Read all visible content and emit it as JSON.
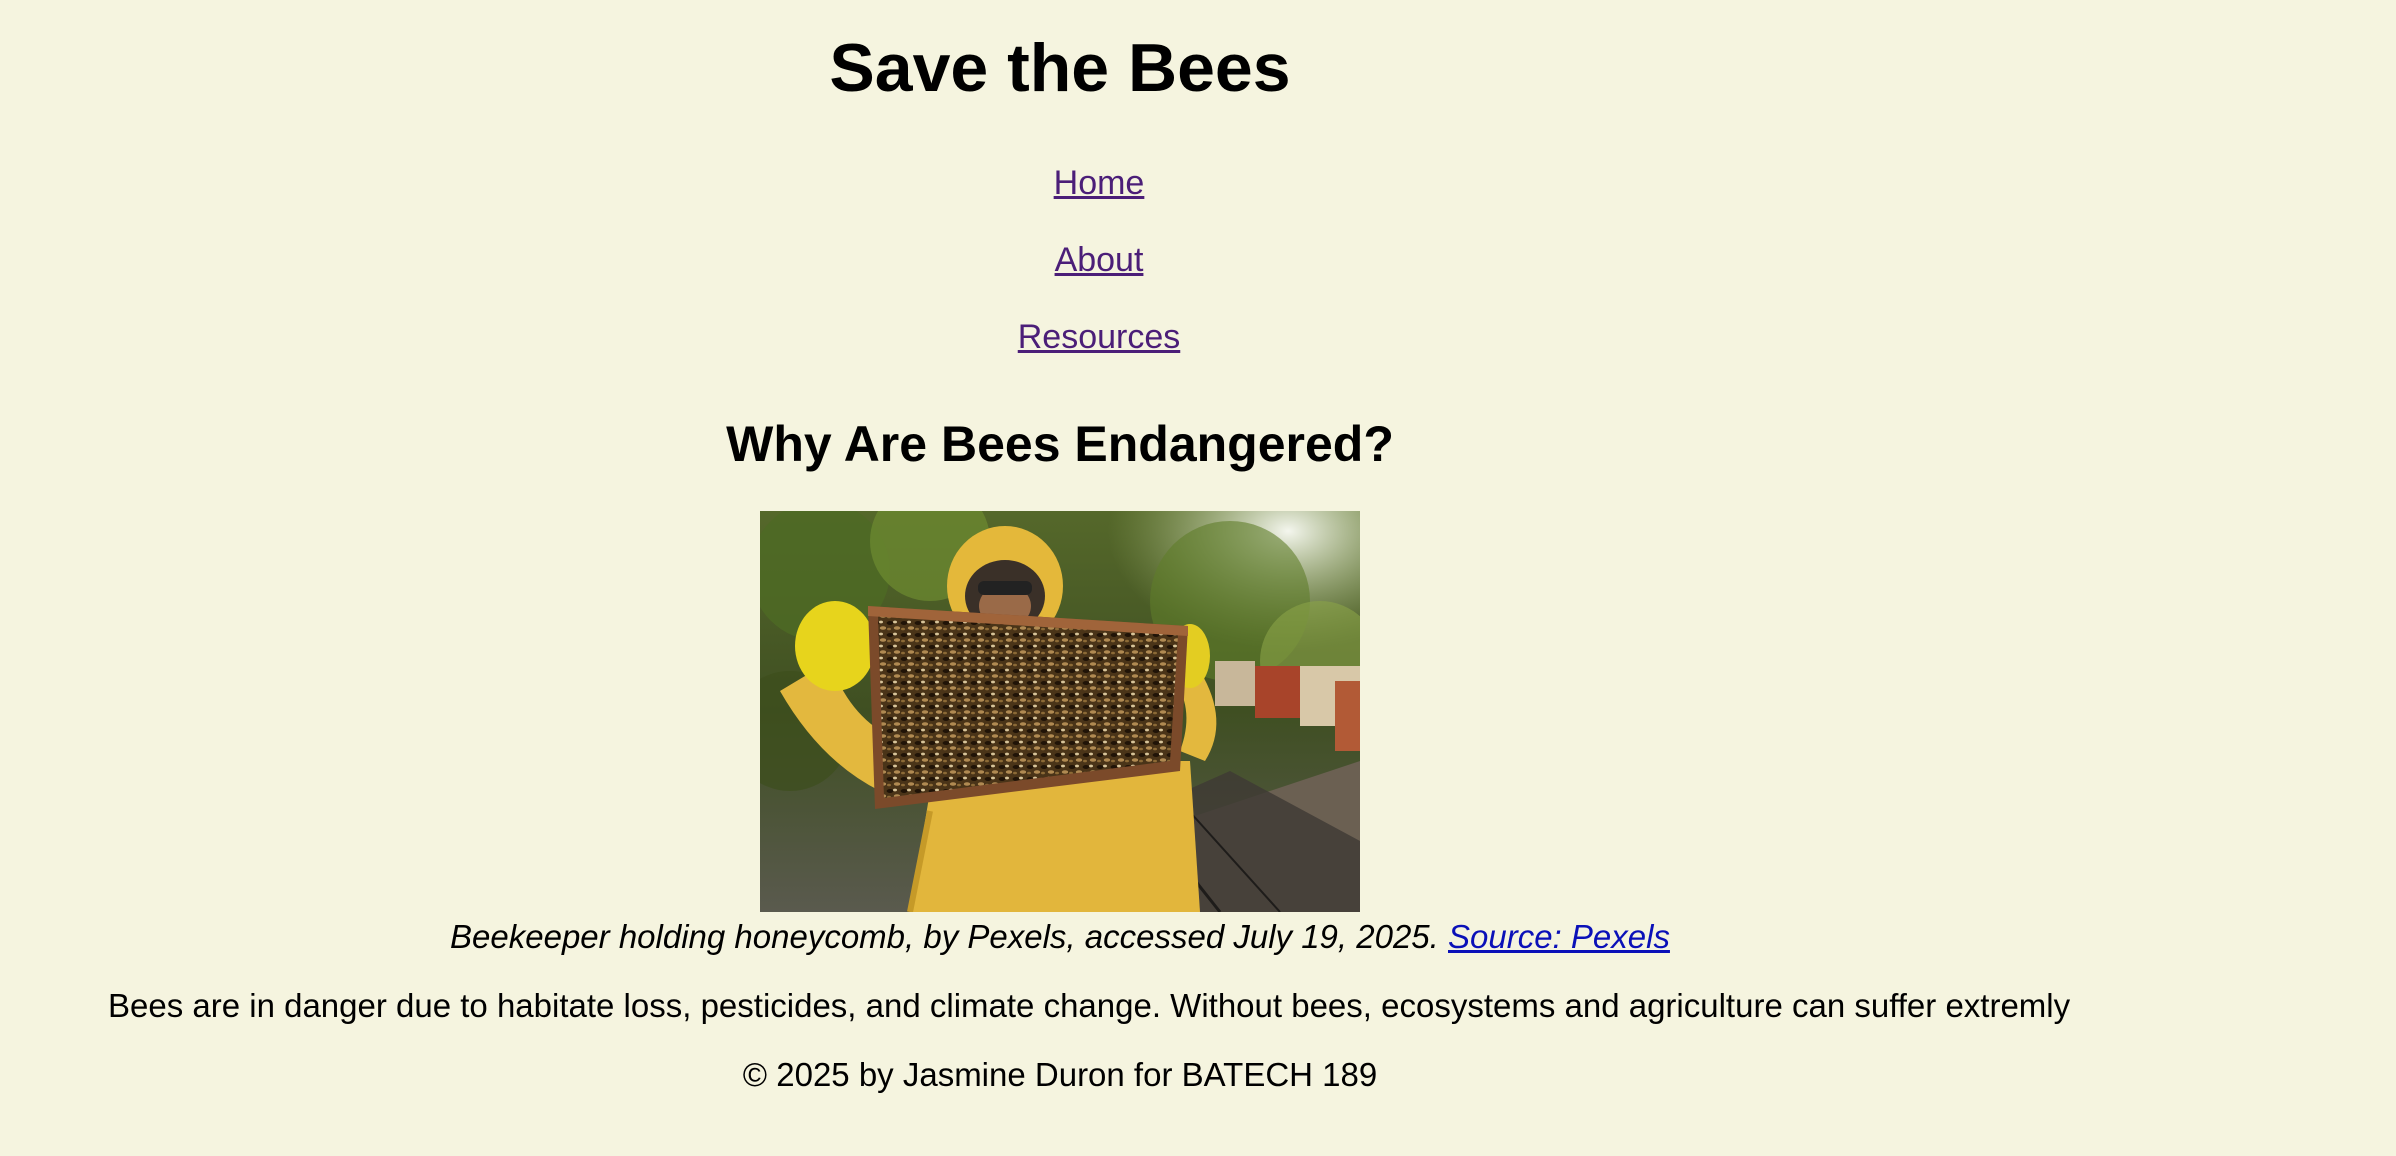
{
  "page": {
    "background_color": "#f5f4df",
    "link_color": "#4b1e78",
    "source_link_color": "#0a10b8"
  },
  "header": {
    "title": "Save the Bees"
  },
  "nav": {
    "items": [
      {
        "label": "Home"
      },
      {
        "label": "About"
      },
      {
        "label": "Resources"
      }
    ]
  },
  "main": {
    "heading": "Why Are Bees Endangered?",
    "image": {
      "alt": "Beekeeper holding honeycomb"
    },
    "caption": {
      "text": "Beekeeper holding honeycomb, by Pexels, accessed July 19, 2025.",
      "link_label": "Source: Pexels"
    },
    "paragraph": "Bees are in danger due to habitate loss, pesticides, and climate change. Without bees, ecosystems and agriculture can suffer extremly"
  },
  "footer": {
    "text": "© 2025 by Jasmine Duron for BATECH 189"
  }
}
